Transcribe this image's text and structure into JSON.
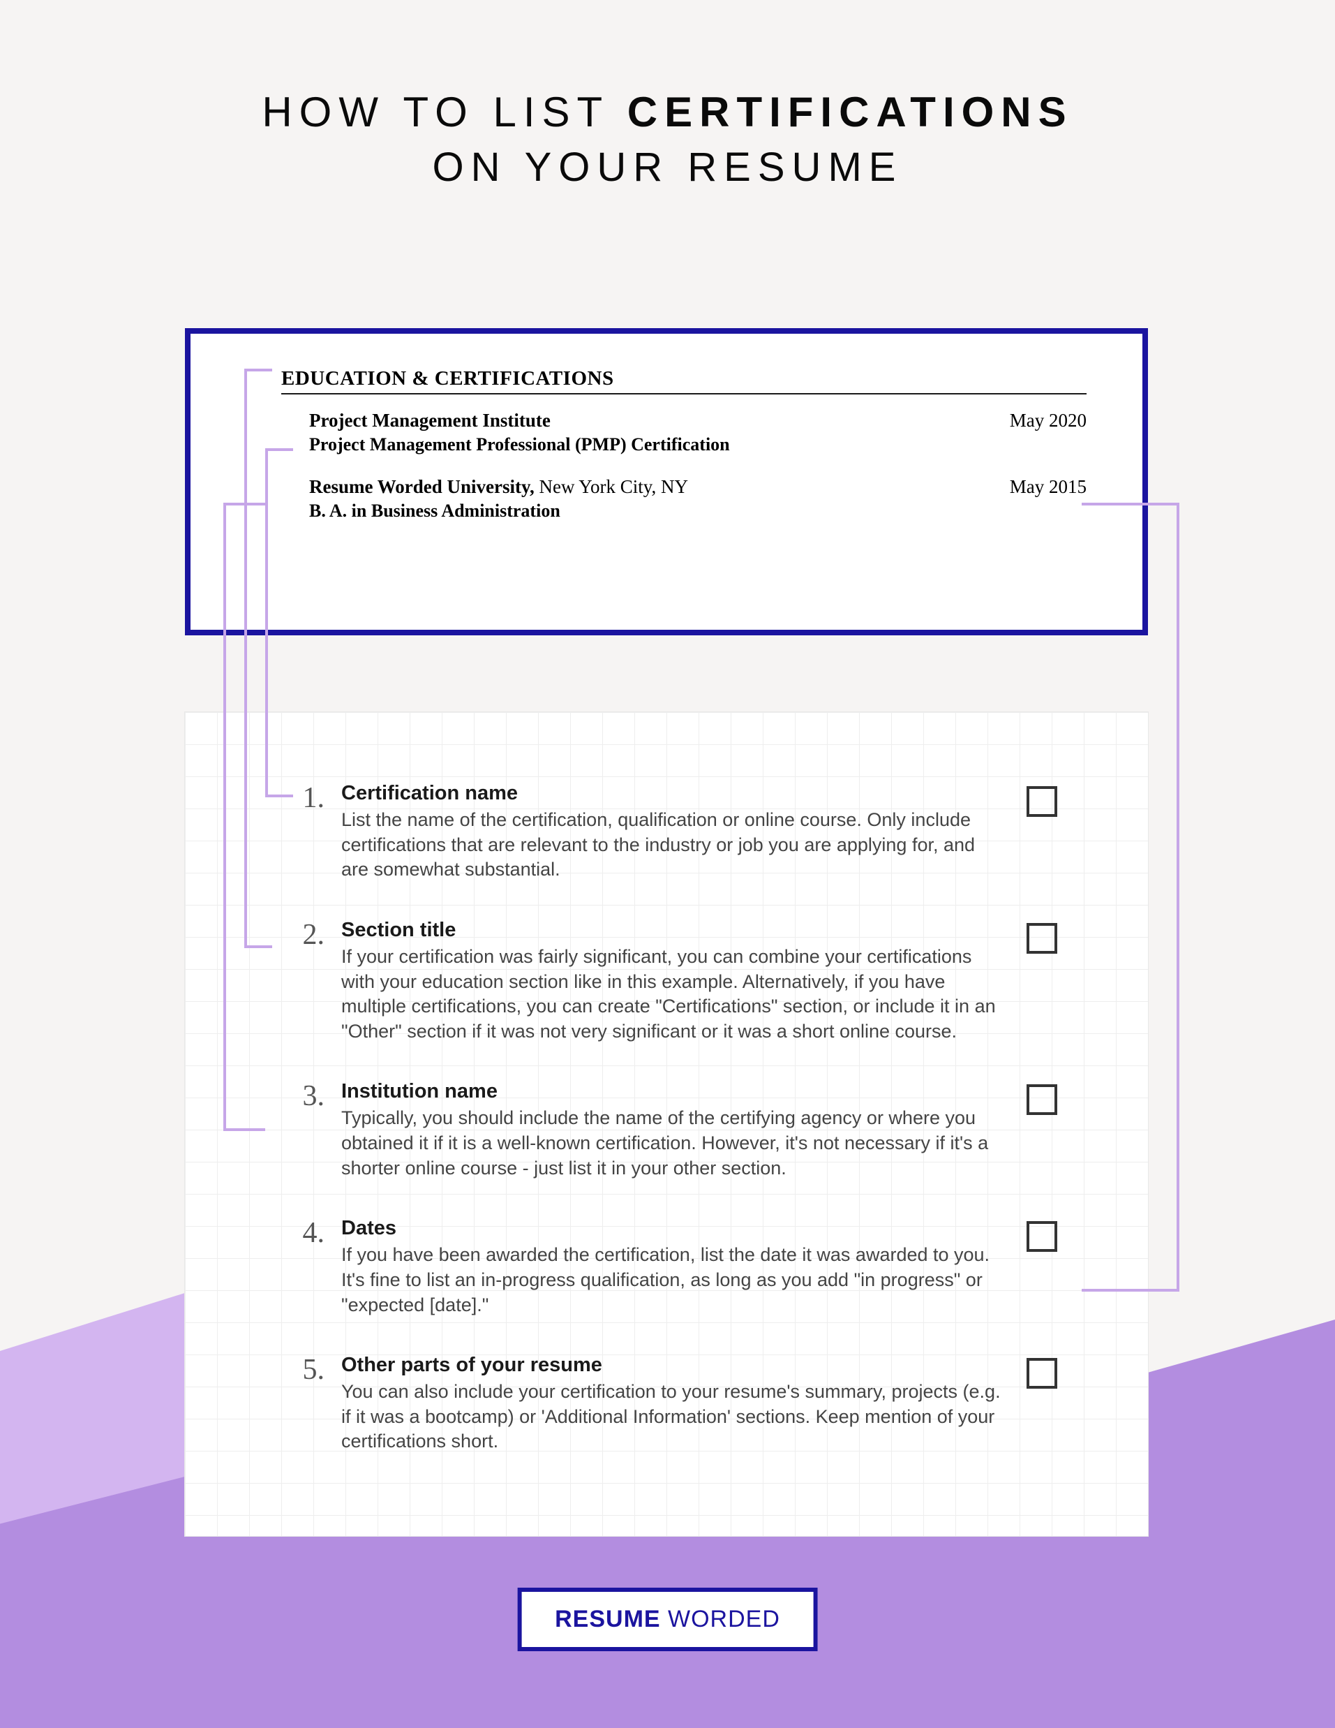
{
  "header": {
    "line1_pre": "HOW TO LIST ",
    "line1_strong": "CERTIFICATIONS",
    "line2": "ON YOUR RESUME"
  },
  "resume": {
    "section_title": "EDUCATION & CERTIFICATIONS",
    "entry1": {
      "title": "Project Management Institute",
      "subtitle": "Project Management Professional (PMP) Certification",
      "date": "May 2020"
    },
    "entry2": {
      "title": "Resume Worded University,",
      "location": " New York City, NY",
      "subtitle": "B. A. in Business Administration",
      "date": "May 2015"
    }
  },
  "checklist": [
    {
      "num": "1.",
      "title": "Certification name",
      "desc": "List the name of the certification, qualification or online course. Only include certifications that are relevant to the industry or job you are applying for, and are somewhat substantial."
    },
    {
      "num": "2.",
      "title": "Section title",
      "desc": "If your certification was fairly significant, you can combine your certifications with your education section like in this example. Alternatively, if you have multiple certifications, you can create \"Certifications\" section, or include it in an \"Other\" section if it was not very significant or it was a short online course."
    },
    {
      "num": "3.",
      "title": "Institution name",
      "desc": "Typically, you should include the name of the certifying agency or where you obtained it if it is a well-known certification. However, it's not necessary if it's a shorter online course - just list it in your other section."
    },
    {
      "num": "4.",
      "title": "Dates",
      "desc": "If you have been awarded the certification, list the date it was awarded to you. It's fine to list an in-progress qualification, as long as you add \"in progress\" or \"expected [date].\""
    },
    {
      "num": "5.",
      "title": "Other parts of your resume",
      "desc": "You can also include your certification to your resume's summary, projects (e.g. if it was a bootcamp) or 'Additional Information' sections. Keep mention of your certifications short."
    }
  ],
  "brand": {
    "strong": "RESUME",
    "light": " WORDED"
  }
}
